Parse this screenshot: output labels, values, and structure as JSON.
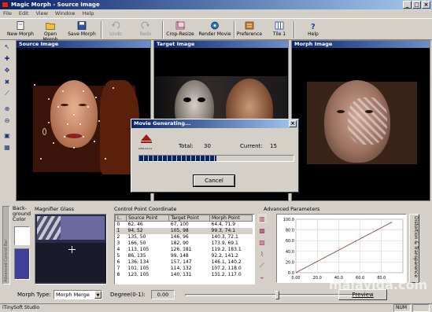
{
  "window": {
    "title": "Magic Morph - Source Image",
    "min": "_",
    "max": "□",
    "close": "×"
  },
  "menu": [
    "File",
    "Edit",
    "View",
    "Window",
    "Help"
  ],
  "toolbar": {
    "new_morph": "New Morph",
    "open_morph": "Open Morph",
    "save_morph": "Save Morph",
    "undo": "Undo",
    "redo": "Redo",
    "crop_resize": "Crop-Resize",
    "render_movie": "Render Movie",
    "preference": "Preference",
    "tile": "Tile 1",
    "help": "Help"
  },
  "panels": {
    "source": "Source Image",
    "target": "Target Image",
    "morph": "Morph Image"
  },
  "dialog": {
    "title": "Movie Generating...",
    "total_label": "Total:",
    "total": "30",
    "current_label": "Current:",
    "current": "15",
    "progress": 0.5,
    "cancel": "Cancel",
    "logo": "ABRAXAS"
  },
  "background": {
    "label_line1": "Back-",
    "label_line2": "ground",
    "label_line3": "Color"
  },
  "magnifier": {
    "label": "Magnifier Glass"
  },
  "advanced_bar": {
    "label": "Advanced Control Bar"
  },
  "cpc": {
    "label": "Control Point Coordinate",
    "headers": [
      "I..",
      "Source Point",
      "Target Point",
      "Morph Point"
    ],
    "rows": [
      [
        "0",
        "62, 46",
        "67, 100",
        "64.4, 71.9"
      ],
      [
        "1",
        "94, 52",
        "105, 98",
        "99.3, 74.1"
      ],
      [
        "2",
        "135, 50",
        "146, 96",
        "140.3, 72.1"
      ],
      [
        "3",
        "166, 50",
        "182, 90",
        "173.9, 69.1"
      ],
      [
        "4",
        "113, 105",
        "126, 181",
        "119.2, 183.1"
      ],
      [
        "5",
        "86, 135",
        "99, 148",
        "92.2, 141.2"
      ],
      [
        "6",
        "136, 134",
        "157, 147",
        "146.1, 140.2"
      ],
      [
        "7",
        "101, 105",
        "114, 132",
        "107.2, 118.0"
      ],
      [
        "8",
        "123, 105",
        "140, 131",
        "131.2, 117.0"
      ]
    ],
    "selected_row": 1
  },
  "advanced": {
    "label": "Advanced Parameters",
    "side_label": "Distortion & Transparence"
  },
  "chart": {
    "y_ticks": [
      "100.0",
      "80.0",
      "60.0",
      "40.0",
      "20.0",
      "0.0"
    ],
    "x_ticks": [
      "0.00",
      "20.0",
      "40.0",
      "60.0",
      "80.0"
    ],
    "line_color": "#a05050"
  },
  "controls": {
    "morph_type_label": "Morph Type:",
    "morph_type": "Morph Merge",
    "degree_label": "Degree(0-1):",
    "degree": "0.00",
    "slider": 0.5,
    "preview": "Preview"
  },
  "status": {
    "left": "iTinySoft Studio",
    "num": "NUM"
  },
  "watermark": "malavida.com"
}
